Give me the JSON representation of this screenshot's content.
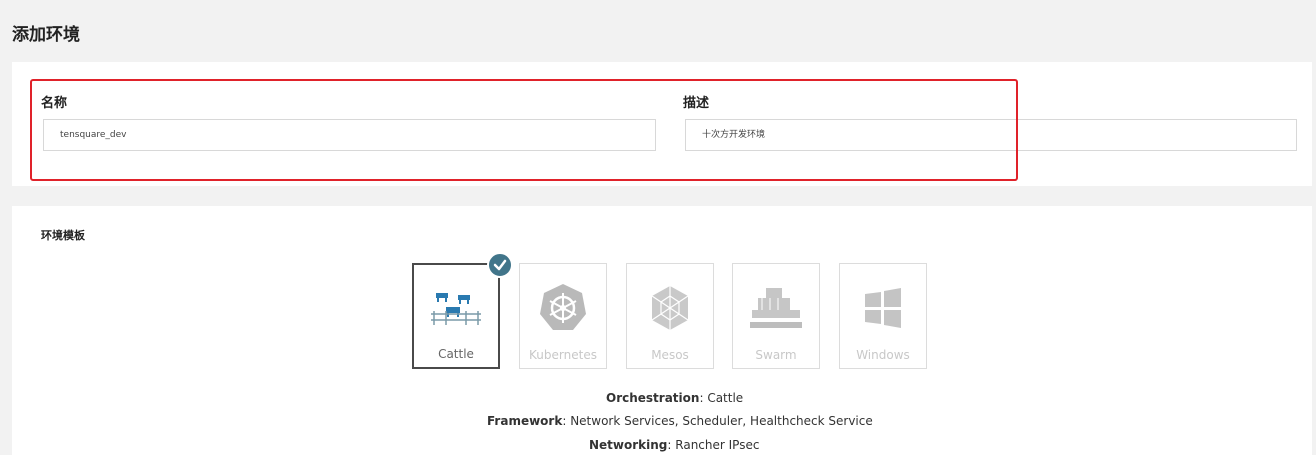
{
  "header": {
    "title": "添加环境"
  },
  "form": {
    "name_label": "名称",
    "name_value": "tensquare_dev",
    "desc_label": "描述",
    "desc_value": "十次方开发环境"
  },
  "templates": {
    "section_label": "环境模板",
    "items": [
      {
        "label": "Cattle",
        "icon": "cattle-icon",
        "selected": true
      },
      {
        "label": "Kubernetes",
        "icon": "kubernetes-icon",
        "selected": false
      },
      {
        "label": "Mesos",
        "icon": "mesos-icon",
        "selected": false
      },
      {
        "label": "Swarm",
        "icon": "swarm-icon",
        "selected": false
      },
      {
        "label": "Windows",
        "icon": "windows-icon",
        "selected": false
      }
    ]
  },
  "details": {
    "orchestration_label": "Orchestration",
    "orchestration_value": "Cattle",
    "framework_label": "Framework",
    "framework_value": "Network Services, Scheduler, Healthcheck Service",
    "networking_label": "Networking",
    "networking_value": "Rancher IPsec"
  },
  "colors": {
    "highlight": "#e0222a",
    "accent": "#41758a",
    "cattle_blue": "#2a7ab0"
  }
}
